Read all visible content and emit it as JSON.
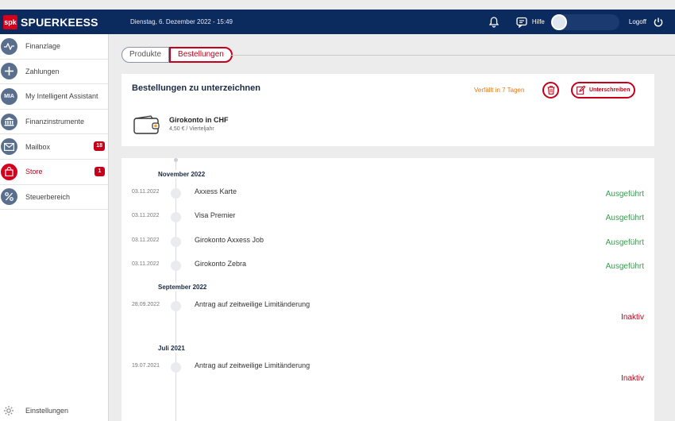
{
  "header": {
    "logo_mark": "spk",
    "brand": "SPUERKEESS",
    "datetime": "Dienstag, 6. Dezember 2022 - 15:49",
    "help_label": "Hilfe",
    "logoff_label": "Logoff",
    "colors": {
      "bar": "#0b2a5e",
      "accent": "#d6001c"
    }
  },
  "sidebar": {
    "items": [
      {
        "label": "Finanzlage",
        "icon": "pulse-icon"
      },
      {
        "label": "Zahlungen",
        "icon": "plus-icon"
      },
      {
        "label": "My Intelligent Assistant",
        "icon": "mia-icon",
        "icon_text": "MIA"
      },
      {
        "label": "Finanzinstrumente",
        "icon": "bank-icon"
      },
      {
        "label": "Mailbox",
        "icon": "envelope-icon",
        "badge": "18"
      },
      {
        "label": "Store",
        "icon": "shopping-bag-icon",
        "badge": "1",
        "active": true
      },
      {
        "label": "Steuerbereich",
        "icon": "percent-icon"
      }
    ],
    "settings_label": "Einstellungen"
  },
  "tabs": {
    "products": "Produkte",
    "orders": "Bestellungen"
  },
  "pending": {
    "title": "Bestellungen zu unterzeichnen",
    "expiry": "Verfällt in 7 Tagen",
    "sign_label": "Unterschreiben",
    "product_name": "Girokonto in CHF",
    "product_price": "4,50 € / Vierteljahr"
  },
  "history": {
    "months": [
      "November 2022",
      "September 2022",
      "Juli 2021"
    ],
    "rows": [
      {
        "date": "03.11.2022",
        "desc": "Axxess Karte",
        "status": "Ausgeführt"
      },
      {
        "date": "03.11.2022",
        "desc": "Visa Premier",
        "status": "Ausgeführt"
      },
      {
        "date": "03.11.2022",
        "desc": "Girokonto Axxess Job",
        "status": "Ausgeführt"
      },
      {
        "date": "03.11.2022",
        "desc": "Girokonto Zebra",
        "status": "Ausgeführt"
      },
      {
        "date": "28.09.2022",
        "desc": "Antrag auf zeitweilige Limitänderung",
        "status": "Inaktiv"
      },
      {
        "date": "19.07.2021",
        "desc": "Antrag auf zeitweilige Limitänderung",
        "status": "Inaktiv"
      }
    ]
  }
}
